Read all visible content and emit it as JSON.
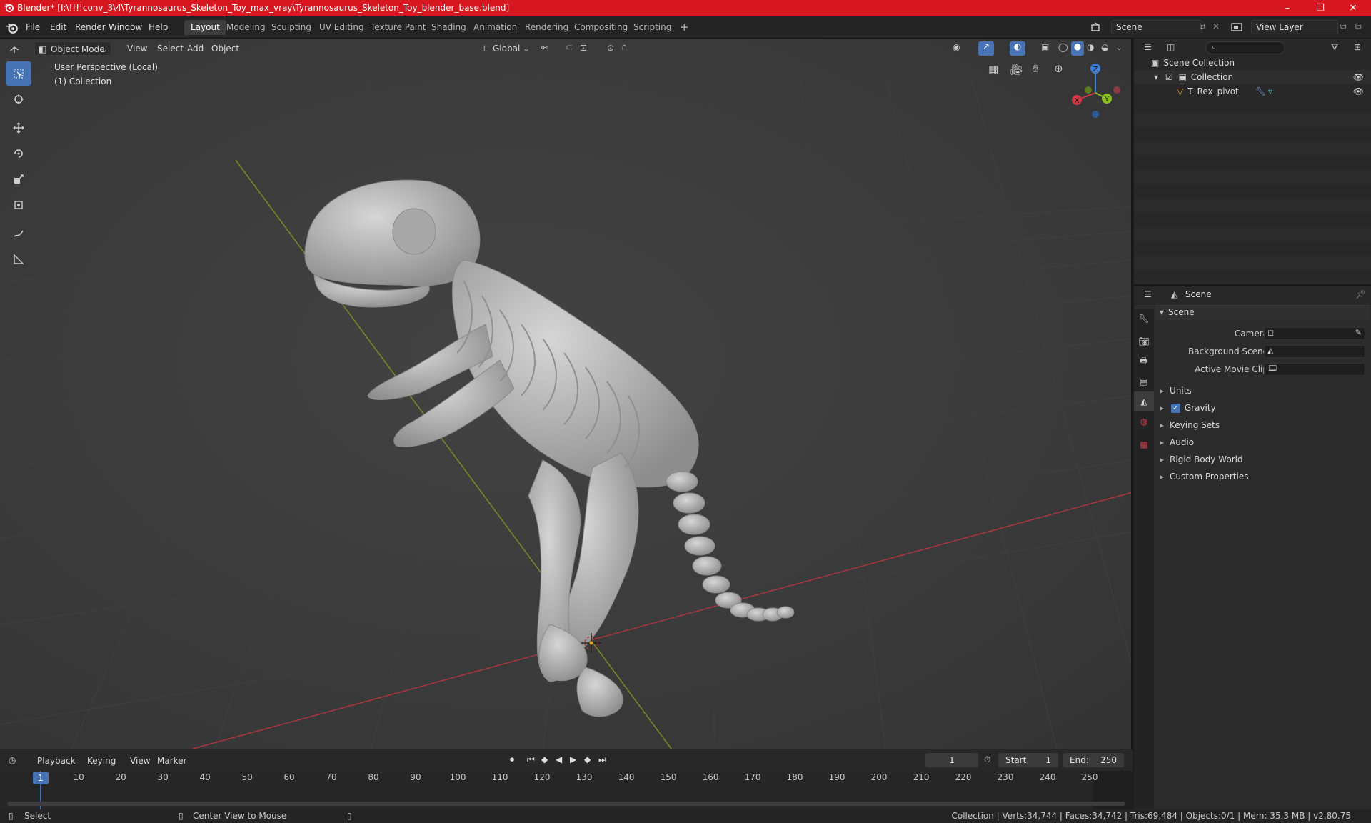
{
  "window": {
    "title": "Blender* [I:\\!!!!conv_3\\4\\Tyrannosaurus_Skeleton_Toy_max_vray\\Tyrannosaurus_Skeleton_Toy_blender_base.blend]",
    "minimize": "–",
    "maximize": "❐",
    "close": "✕"
  },
  "menus": [
    "File",
    "Edit",
    "Render",
    "Window",
    "Help"
  ],
  "workspace_tabs": [
    "Layout",
    "Modeling",
    "Sculpting",
    "UV Editing",
    "Texture Paint",
    "Shading",
    "Animation",
    "Rendering",
    "Compositing",
    "Scripting"
  ],
  "active_workspace": "Layout",
  "add_workspace": "+",
  "scene_selector": "Scene",
  "view_layer_selector": "View Layer",
  "viewport": {
    "mode": "Object Mode",
    "menus": [
      "View",
      "Select",
      "Add",
      "Object"
    ],
    "transform_orientation": "Global",
    "perspective_label": "User Perspective (Local)",
    "collection_label": "(1) Collection",
    "gizmo": {
      "z": "Z",
      "y": "Y",
      "x": "X"
    }
  },
  "outliner": {
    "items": [
      {
        "label": "Scene Collection",
        "level": 0
      },
      {
        "label": "Collection",
        "level": 1
      },
      {
        "label": "T_Rex_pivot",
        "level": 2
      }
    ]
  },
  "properties": {
    "header": "Scene",
    "section": "Scene",
    "fields": [
      {
        "label": "Camera"
      },
      {
        "label": "Background Scene"
      },
      {
        "label": "Active Movie Clip"
      }
    ],
    "panels": [
      "Units",
      "Gravity",
      "Keying Sets",
      "Audio",
      "Rigid Body World",
      "Custom Properties"
    ],
    "gravity_checked": true
  },
  "timeline": {
    "menus": [
      "Playback",
      "Keying",
      "View",
      "Marker"
    ],
    "current_frame": "1",
    "start_label": "Start:",
    "start": "1",
    "end_label": "End:",
    "end": "250",
    "ticks": [
      "1",
      "10",
      "20",
      "30",
      "40",
      "50",
      "60",
      "70",
      "80",
      "90",
      "100",
      "110",
      "120",
      "130",
      "140",
      "150",
      "160",
      "170",
      "180",
      "190",
      "200",
      "210",
      "220",
      "230",
      "240",
      "250"
    ]
  },
  "statusbar": {
    "select": "Select",
    "center_view": "Center View to Mouse",
    "stats": "Collection | Verts:34,744 | Faces:34,742 | Tris:69,484 | Objects:0/1 | Mem: 35.3 MB | v2.80.75"
  },
  "colors": {
    "title_bar": "#d7171f",
    "active_tool": "#4772b3",
    "x_axis": "#cf3b45",
    "y_axis": "#8bbf1e",
    "z_axis": "#3b7fd6"
  }
}
